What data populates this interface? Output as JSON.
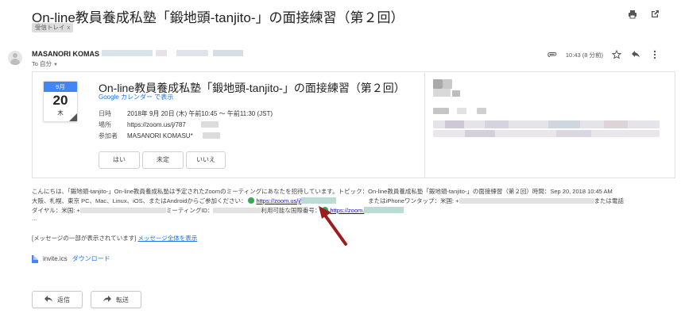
{
  "email": {
    "subject": "On-line教員養成私塾「鍛地頭-tanjito-」の面接練習（第２回）",
    "label": "受信トレイ",
    "label_close": "x",
    "sender_name": "MASANORI KOMAS",
    "recipient": "To 自分",
    "time": "10:43 (8 分前)"
  },
  "event": {
    "month": "9月",
    "day": "20",
    "weekday": "木",
    "title": "On-line教員養成私塾「鍛地頭-tanjito-」の面接練習（第２回）",
    "gcal_link": "Google カレンダー で表示",
    "when_label": "日時",
    "when_value": "2018年 9月 20日 (木) 午前10:45 ～ 午前11:30 (JST)",
    "where_label": "場所",
    "where_value": "https://zoom.us/j/787",
    "who_label": "参加者",
    "who_value": "MASANORI KOMASU*",
    "rsvp": [
      "はい",
      "未定",
      "いいえ"
    ]
  },
  "body": {
    "line1": "こんにちは、「鍛地頭-tanjito-」On-line教員養成私塾は予定されたZoomのミーティングにあなたを招待しています。トピック：On-line教員養成私塾「鍛地頭-tanjito-」の面接練習（第２回）時間：Sep 20, 2018 10:45 AM",
    "line2_a": "大阪、札幌、東京 PC、Mac、Linux、iOS、またはAndroidからご参加ください：",
    "line2_link": "https://zoom.us/j/",
    "line2_b": "またはiPhoneワンタップ：米国: +",
    "line2_c": "または電話",
    "line3_a": "ダイヤル：米国: +",
    "line3_b": "ミーティングID：",
    "line3_c": "利用可能な国際番号：",
    "line3_link": "https://zoom.",
    "ellipsis": "...",
    "truncated_notice": "[メッセージの一部が表示されています]",
    "view_full": "メッセージ全体を表示"
  },
  "attachment": {
    "filename": "invite.ics",
    "download": "ダウンロード"
  },
  "actions": {
    "reply": "返信",
    "forward": "転送"
  },
  "colors": {
    "accent_blue": "#4285f4",
    "link_blue": "#1a73e8",
    "arrow_red": "#9b1c1c",
    "check_green": "#34a853"
  }
}
